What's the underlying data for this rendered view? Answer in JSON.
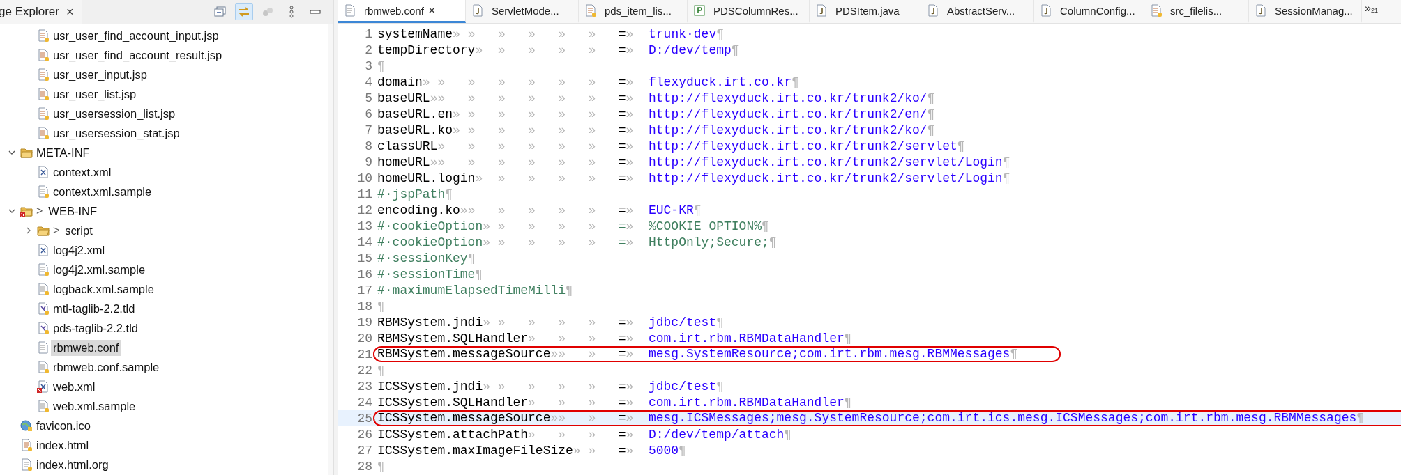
{
  "explorer": {
    "title": "ge Explorer",
    "close": "×",
    "toolbar": [
      {
        "kind": "collapse",
        "on": false
      },
      {
        "kind": "link",
        "on": true
      },
      {
        "kind": "focus",
        "disabled": true
      },
      {
        "kind": "menu",
        "disabled": false
      },
      {
        "kind": "minimize",
        "disabled": false
      }
    ],
    "tree": {
      "continued": [
        {
          "label": "usr_user_find_account_input.jsp",
          "kind": "jsp",
          "selected": false,
          "error": false
        },
        {
          "label": "usr_user_find_account_result.jsp",
          "kind": "jsp",
          "selected": false,
          "error": false
        },
        {
          "label": "usr_user_input.jsp",
          "kind": "jsp",
          "selected": false,
          "error": false
        },
        {
          "label": "usr_user_list.jsp",
          "kind": "jsp",
          "selected": false,
          "error": false
        },
        {
          "label": "usr_usersession_list.jsp",
          "kind": "jsp",
          "selected": false,
          "error": false
        },
        {
          "label": "usr_usersession_stat.jsp",
          "kind": "jsp",
          "selected": false,
          "error": false
        }
      ],
      "items": [
        {
          "label": "META-INF",
          "kind": "folder",
          "expanded": true,
          "selected": false,
          "error": false,
          "children": [
            {
              "label": "context.xml",
              "kind": "xml",
              "selected": false,
              "error": false
            },
            {
              "label": "context.xml.sample",
              "kind": "file",
              "selected": false,
              "error": false
            }
          ]
        },
        {
          "label": "WEB-INF",
          "prefix": ">",
          "kind": "folder",
          "expanded": true,
          "selected": false,
          "error": true,
          "children": [
            {
              "label": "script",
              "prefix": ">",
              "kind": "folder",
              "expanded": false,
              "selected": false,
              "error": false
            },
            {
              "label": "log4j2.xml",
              "kind": "xml",
              "selected": false,
              "error": false
            },
            {
              "label": "log4j2.xml.sample",
              "kind": "file",
              "selected": false,
              "error": false
            },
            {
              "label": "logback.xml.sample",
              "kind": "file",
              "selected": false,
              "error": false
            },
            {
              "label": "mtl-taglib-2.2.tld",
              "kind": "tld",
              "selected": false,
              "error": false
            },
            {
              "label": "pds-taglib-2.2.tld",
              "kind": "tld",
              "selected": false,
              "error": false
            },
            {
              "label": "rbmweb.conf",
              "kind": "conf",
              "selected": true,
              "error": false
            },
            {
              "label": "rbmweb.conf.sample",
              "kind": "file",
              "selected": false,
              "error": false
            },
            {
              "label": "web.xml",
              "kind": "xml",
              "selected": false,
              "error": true
            },
            {
              "label": "web.xml.sample",
              "kind": "file",
              "selected": false,
              "error": false
            }
          ]
        },
        {
          "label": "favicon.ico",
          "kind": "globe",
          "selected": false,
          "error": false
        },
        {
          "label": "index.html",
          "kind": "html",
          "selected": false,
          "error": false
        },
        {
          "label": "index.html.org",
          "kind": "file",
          "selected": false,
          "error": false
        }
      ]
    }
  },
  "editor": {
    "tabs": [
      {
        "label": "rbmweb.conf",
        "kind": "conf",
        "selected": true,
        "close": "×"
      },
      {
        "label": "ServletMode...",
        "kind": "java",
        "selected": false
      },
      {
        "label": "pds_item_lis...",
        "kind": "jsp",
        "selected": false
      },
      {
        "label": "PDSColumnRes...",
        "kind": "type",
        "selected": false
      },
      {
        "label": "PDSItem.java",
        "kind": "java",
        "selected": false
      },
      {
        "label": "AbstractServ...",
        "kind": "java",
        "selected": false
      },
      {
        "label": "ColumnConfig...",
        "kind": "java",
        "selected": false
      },
      {
        "label": "src_filelis...",
        "kind": "jsp",
        "selected": false
      },
      {
        "label": "SessionManag...",
        "kind": "java",
        "selected": false
      }
    ],
    "overflow": "»",
    "overflow_count": "21",
    "whitespace": {
      "tab": "»",
      "eol": "¶"
    },
    "lines": [
      {
        "n": "1",
        "kind": "pair",
        "key": "systemName",
        "sep": "=",
        "value": "trunk·dev",
        "current": false
      },
      {
        "n": "2",
        "kind": "pair",
        "key": "tempDirectory",
        "sep": "=",
        "value": "D:/dev/temp",
        "current": false
      },
      {
        "n": "3",
        "kind": "blank",
        "current": false
      },
      {
        "n": "4",
        "kind": "pair",
        "key": "domain",
        "sep": "=",
        "value": "flexyduck.irt.co.kr",
        "current": false
      },
      {
        "n": "5",
        "kind": "pair",
        "key": "baseURL",
        "sep": "=",
        "value": "http://flexyduck.irt.co.kr/trunk2/ko/",
        "current": false
      },
      {
        "n": "6",
        "kind": "pair",
        "key": "baseURL.en",
        "sep": "=",
        "value": "http://flexyduck.irt.co.kr/trunk2/en/",
        "current": false
      },
      {
        "n": "7",
        "kind": "pair",
        "key": "baseURL.ko",
        "sep": "=",
        "value": "http://flexyduck.irt.co.kr/trunk2/ko/",
        "current": false
      },
      {
        "n": "8",
        "kind": "pair",
        "key": "classURL",
        "sep": "=",
        "value": "http://flexyduck.irt.co.kr/trunk2/servlet",
        "current": false
      },
      {
        "n": "9",
        "kind": "pair",
        "key": "homeURL",
        "sep": "=",
        "value": "http://flexyduck.irt.co.kr/trunk2/servlet/Login",
        "current": false
      },
      {
        "n": "10",
        "kind": "pair",
        "key": "homeURL.login",
        "sep": "=",
        "value": "http://flexyduck.irt.co.kr/trunk2/servlet/Login",
        "current": false
      },
      {
        "n": "11",
        "kind": "comment",
        "key": "#·jspPath",
        "current": false
      },
      {
        "n": "12",
        "kind": "pair",
        "key": "encoding.ko",
        "sep": "=",
        "value": "EUC-KR",
        "current": false
      },
      {
        "n": "13",
        "kind": "comment",
        "key": "#·cookieOption",
        "sep": "=",
        "value": "%COOKIE_OPTION%",
        "current": false
      },
      {
        "n": "14",
        "kind": "comment",
        "key": "#·cookieOption",
        "sep": "=",
        "value": "HttpOnly;Secure;",
        "current": false
      },
      {
        "n": "15",
        "kind": "comment",
        "key": "#·sessionKey",
        "current": false
      },
      {
        "n": "16",
        "kind": "comment",
        "key": "#·sessionTime",
        "current": false
      },
      {
        "n": "17",
        "kind": "comment",
        "key": "#·maximumElapsedTimeMilli",
        "current": false
      },
      {
        "n": "18",
        "kind": "blank",
        "current": false
      },
      {
        "n": "19",
        "kind": "pair",
        "key": "RBMSystem.jndi",
        "sep": "=",
        "value": "jdbc/test",
        "current": false
      },
      {
        "n": "20",
        "kind": "pair",
        "key": "RBMSystem.SQLHandler",
        "sep": "=",
        "value": "com.irt.rbm.RBMDataHandler",
        "current": false
      },
      {
        "n": "21",
        "kind": "pair",
        "key": "RBMSystem.messageSource",
        "sep": "=",
        "value": "mesg.SystemResource;com.irt.rbm.mesg.RBMMessages",
        "current": false,
        "circled": true
      },
      {
        "n": "22",
        "kind": "blank",
        "current": false
      },
      {
        "n": "23",
        "kind": "pair",
        "key": "ICSSystem.jndi",
        "sep": "=",
        "value": "jdbc/test",
        "current": false
      },
      {
        "n": "24",
        "kind": "pair",
        "key": "ICSSystem.SQLHandler",
        "sep": "=",
        "value": "com.irt.rbm.RBMDataHandler",
        "current": false
      },
      {
        "n": "25",
        "kind": "pair",
        "key": "ICSSystem.messageSource",
        "sep": "=",
        "value": "mesg.ICSMessages;mesg.SystemResource;com.irt.ics.mesg.ICSMessages;com.irt.rbm.mesg.RBMMessages",
        "current": true,
        "circled": true
      },
      {
        "n": "26",
        "kind": "pair",
        "key": "ICSSystem.attachPath",
        "sep": "=",
        "value": "D:/dev/temp/attach",
        "current": false
      },
      {
        "n": "27",
        "kind": "pair",
        "key": "ICSSystem.maxImageFileSize",
        "sep": "=",
        "value": "5000",
        "current": false
      },
      {
        "n": "28",
        "kind": "blank",
        "current": false
      }
    ]
  }
}
